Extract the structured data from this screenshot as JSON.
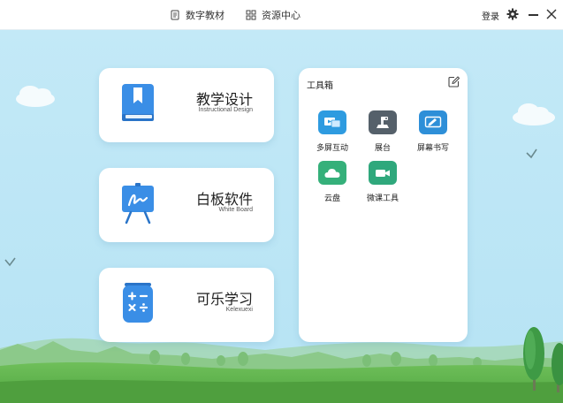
{
  "topbar": {
    "nav": [
      {
        "label": "数字教材",
        "icon": "book-icon"
      },
      {
        "label": "资源中心",
        "icon": "grid-icon"
      }
    ],
    "login_label": "登录"
  },
  "cards": [
    {
      "title": "教学设计",
      "subtitle": "Instructional Design",
      "icon": "bookmark-book-icon",
      "color": "#3a8ee6"
    },
    {
      "title": "白板软件",
      "subtitle": "White Board",
      "icon": "whiteboard-icon",
      "color": "#3a8ee6"
    },
    {
      "title": "可乐学习",
      "subtitle": "Kelexuexi",
      "icon": "calculator-can-icon",
      "color": "#3a8ee6"
    }
  ],
  "toolbox": {
    "title": "工具箱",
    "tools": [
      {
        "label": "多屏互动",
        "icon": "multi-screen-icon",
        "color": "#2e9be0"
      },
      {
        "label": "展台",
        "icon": "document-camera-icon",
        "color": "#55606a"
      },
      {
        "label": "屏幕书写",
        "icon": "screen-write-icon",
        "color": "#2e8fd8"
      },
      {
        "label": "云盘",
        "icon": "cloud-icon",
        "color": "#35b07a"
      },
      {
        "label": "微课工具",
        "icon": "video-camera-icon",
        "color": "#2fa87c"
      }
    ]
  }
}
